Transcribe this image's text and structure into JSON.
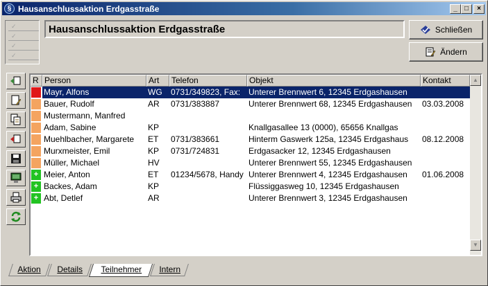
{
  "window": {
    "title": "Hausanschlussaktion Erdgasstraße",
    "controls": {
      "minimize": "_",
      "maximize": "□",
      "close": "×"
    }
  },
  "header": {
    "title_value": "Hausanschlussaktion Erdgasstraße",
    "buttons": {
      "close_label": "Schließen",
      "edit_label": "Ändern"
    }
  },
  "toolbar": {
    "items": [
      {
        "name": "add-icon",
        "color": "#3a8a3a"
      },
      {
        "name": "edit-doc-icon",
        "color": "#8a6a20"
      },
      {
        "name": "copy-doc-icon",
        "color": "#8a6a20"
      },
      {
        "name": "remove-icon",
        "color": "#c02020"
      },
      {
        "name": "save-icon",
        "color": "#000000"
      },
      {
        "name": "monitor-icon",
        "color": "#2a6a2a"
      },
      {
        "name": "print-icon",
        "color": "#303030"
      },
      {
        "name": "refresh-icon",
        "color": "#1f8a1f"
      }
    ]
  },
  "table": {
    "columns": [
      "R",
      "Person",
      "Art",
      "Telefon",
      "Objekt",
      "Kontakt"
    ],
    "rows": [
      {
        "marker": "",
        "marker_color": "#e01818",
        "person": "Mayr, Alfons",
        "art": "WG",
        "telefon": "0731/349823, Fax:",
        "objekt": "Unterer Brennwert 6, 12345 Erdgashausen",
        "kontakt": "",
        "selected": true
      },
      {
        "marker": "",
        "marker_color": "#f4a460",
        "person": "Bauer, Rudolf",
        "art": "AR",
        "telefon": "0731/383887",
        "objekt": "Unterer Brennwert 68, 12345 Erdgashausen",
        "kontakt": "03.03.2008",
        "selected": false
      },
      {
        "marker": "",
        "marker_color": "#f4a460",
        "person": "Mustermann, Manfred",
        "art": "",
        "telefon": "",
        "objekt": "",
        "kontakt": "",
        "selected": false
      },
      {
        "marker": "",
        "marker_color": "#f4a460",
        "person": "Adam, Sabine",
        "art": "KP",
        "telefon": "",
        "objekt": "Knallgasallee 13 (0000), 65656 Knallgas",
        "kontakt": "",
        "selected": false
      },
      {
        "marker": "",
        "marker_color": "#f4a460",
        "person": "Muehlbacher, Margarete",
        "art": "ET",
        "telefon": "0731/383661",
        "objekt": "Hinterm Gaswerk 125a, 12345 Erdgashaus",
        "kontakt": "08.12.2008",
        "selected": false
      },
      {
        "marker": "",
        "marker_color": "#f4a460",
        "person": "Murxmeister, Emil",
        "art": "KP",
        "telefon": "0731/724831",
        "objekt": "Erdgasacker 12, 12345 Erdgashausen",
        "kontakt": "",
        "selected": false
      },
      {
        "marker": "",
        "marker_color": "#f4a460",
        "person": "Müller, Michael",
        "art": "HV",
        "telefon": "",
        "objekt": "Unterer Brennwert 55, 12345 Erdgashausen",
        "kontakt": "",
        "selected": false
      },
      {
        "marker": "+",
        "marker_color": "#22c322",
        "person": "Meier, Anton",
        "art": "ET",
        "telefon": "01234/5678, Handy",
        "objekt": "Unterer Brennwert 4, 12345 Erdgashausen",
        "kontakt": "01.06.2008",
        "selected": false
      },
      {
        "marker": "+",
        "marker_color": "#22c322",
        "person": "Backes, Adam",
        "art": "KP",
        "telefon": "",
        "objekt": "Flüssiggasweg 10, 12345 Erdgashausen",
        "kontakt": "",
        "selected": false
      },
      {
        "marker": "+",
        "marker_color": "#22c322",
        "person": "Abt, Detlef",
        "art": "AR",
        "telefon": "",
        "objekt": "Unterer Brennwert 3, 12345 Erdgashausen",
        "kontakt": "",
        "selected": false
      }
    ]
  },
  "tabs": [
    {
      "label": "Aktion",
      "active": false
    },
    {
      "label": "Details",
      "active": false
    },
    {
      "label": "Teilnehmer",
      "active": true
    },
    {
      "label": "Intern",
      "active": false
    }
  ]
}
